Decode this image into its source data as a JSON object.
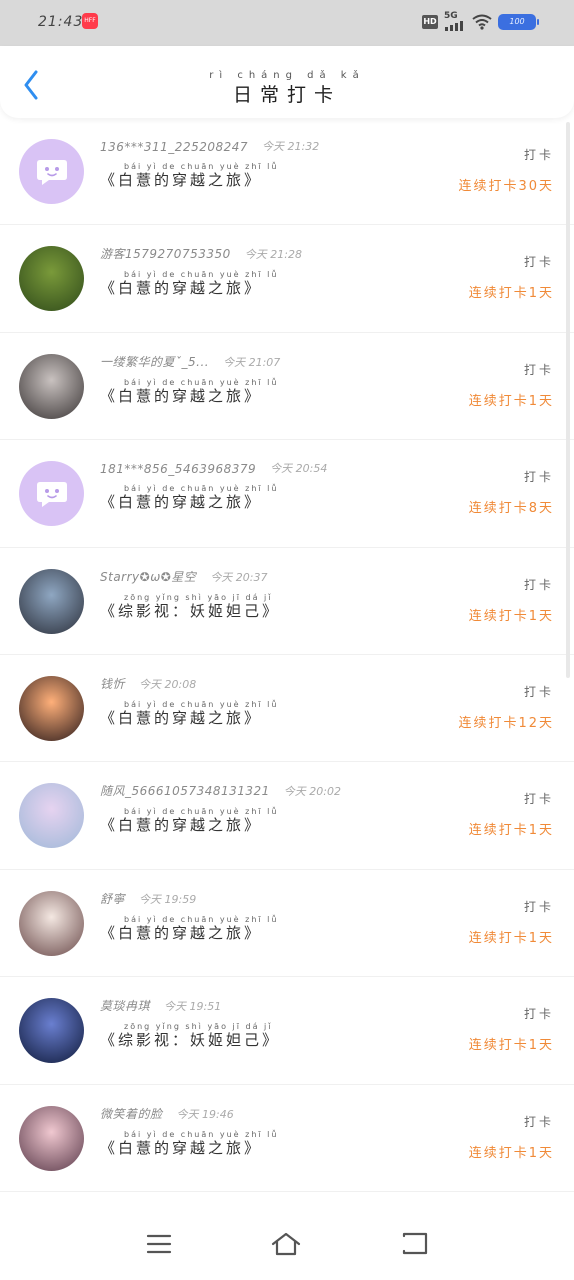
{
  "status_bar": {
    "time": "21:43",
    "app_badge": "HFF",
    "hd": "HD",
    "network": "5G",
    "battery": "100"
  },
  "header": {
    "title_pinyin": "rì cháng dǎ kǎ",
    "title": "日常打卡"
  },
  "check_label": "打卡",
  "items": [
    {
      "name": "136***311_225208247",
      "time": "今天 21:32",
      "book": "《白薏的穿越之旅》",
      "streak": "连续打卡30天",
      "avatar": "default"
    },
    {
      "name": "游客1579270753350",
      "time": "今天 21:28",
      "book": "《白薏的穿越之旅》",
      "streak": "连续打卡1天",
      "avatar": "photo"
    },
    {
      "name": "一缕繁华的夏ˇ_5...",
      "time": "今天 21:07",
      "book": "《白薏的穿越之旅》",
      "streak": "连续打卡1天",
      "avatar": "photo"
    },
    {
      "name": "181***856_5463968379",
      "time": "今天 20:54",
      "book": "《白薏的穿越之旅》",
      "streak": "连续打卡8天",
      "avatar": "default"
    },
    {
      "name": "Starry✪ω✪星空",
      "time": "今天 20:37",
      "book": "《综影视：妖姬妲己》",
      "streak": "连续打卡1天",
      "avatar": "photo"
    },
    {
      "name": "钱忻",
      "time": "今天 20:08",
      "book": "《白薏的穿越之旅》",
      "streak": "连续打卡12天",
      "avatar": "photo"
    },
    {
      "name": "随风_56661057348131321",
      "time": "今天 20:02",
      "book": "《白薏的穿越之旅》",
      "streak": "连续打卡1天",
      "avatar": "photo"
    },
    {
      "name": "舒寧",
      "time": "今天 19:59",
      "book": "《白薏的穿越之旅》",
      "streak": "连续打卡1天",
      "avatar": "photo"
    },
    {
      "name": "莫琰冉琪",
      "time": "今天 19:51",
      "book": "《综影视：妖姬妲己》",
      "streak": "连续打卡1天",
      "avatar": "photo"
    },
    {
      "name": "微笑着的脸",
      "time": "今天 19:46",
      "book": "《白薏的穿越之旅》",
      "streak": "连续打卡1天",
      "avatar": "photo"
    }
  ],
  "book_pinyin": {
    "《白薏的穿越之旅》": "bái yì de chuān yuè zhī lǚ",
    "《综影视：妖姬妲己》": "zōng yǐng shì   yāo jī dá jǐ"
  },
  "colors": {
    "accent_blue": "#2f8ef0",
    "streak_orange": "#f08a38",
    "default_avatar": "#d9c3f5"
  }
}
